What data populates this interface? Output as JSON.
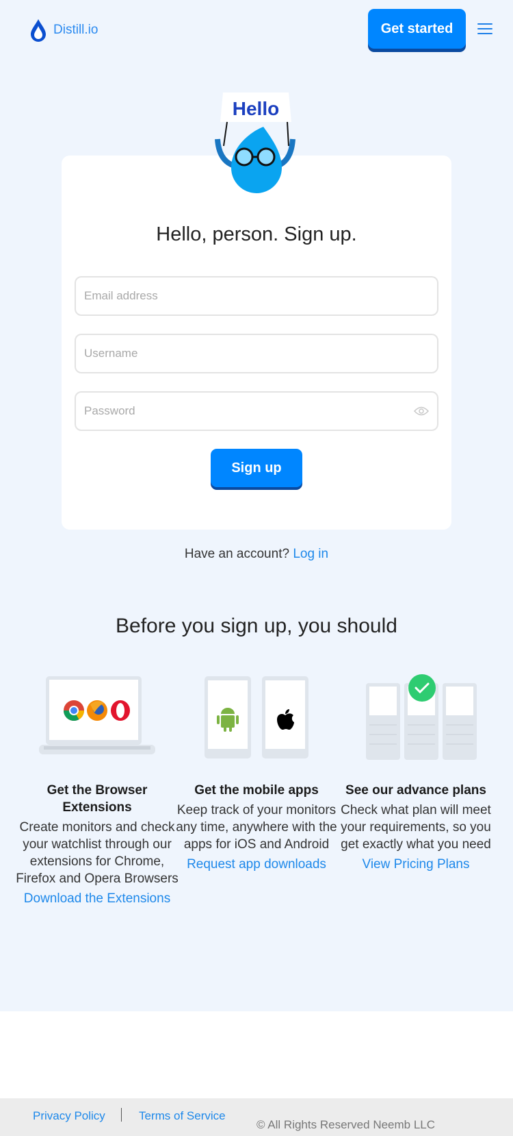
{
  "header": {
    "brand": "Distill.io",
    "get_started_label": "Get started",
    "menu_icon": "hamburger-menu-icon"
  },
  "mascot": {
    "sign_text": "Hello"
  },
  "signup_form": {
    "title": "Hello, person. Sign up.",
    "email": {
      "value": "",
      "placeholder": "Email address"
    },
    "username": {
      "value": "",
      "placeholder": "Username"
    },
    "password": {
      "value": "",
      "placeholder": "Password",
      "toggle_icon": "eye-icon"
    },
    "submit_label": "Sign up"
  },
  "login_prompt": {
    "text": "Have an account?",
    "link_label": "Log in"
  },
  "before_section": {
    "title": "Before you sign up, you should",
    "items": [
      {
        "title": "Get the Browser Extensions",
        "description": "Create monitors and check your watchlist through our extensions for Chrome, Firefox and Opera Browsers",
        "link_label": "Download the Extensions",
        "icons": [
          "chrome-icon",
          "firefox-icon",
          "opera-icon"
        ]
      },
      {
        "title": "Get the mobile apps",
        "description": "Keep track of your monitors any time, anywhere with the apps for iOS and Android",
        "link_label": "Request app downloads",
        "icons": [
          "android-icon",
          "apple-icon"
        ]
      },
      {
        "title": "See our advance plans",
        "description": "Check what plan will meet your requirements, so you get exactly what you need",
        "link_label": "View Pricing Plans",
        "icons": [
          "check-badge-icon"
        ]
      }
    ]
  },
  "footer": {
    "privacy_label": "Privacy Policy",
    "terms_label": "Terms of Service",
    "copyright": "© All Rights Reserved Neemb LLC"
  },
  "colors": {
    "brand_blue": "#0086ff",
    "link_blue": "#1d88ea",
    "page_bg": "#eff5fd",
    "success_green": "#2ecc71"
  }
}
